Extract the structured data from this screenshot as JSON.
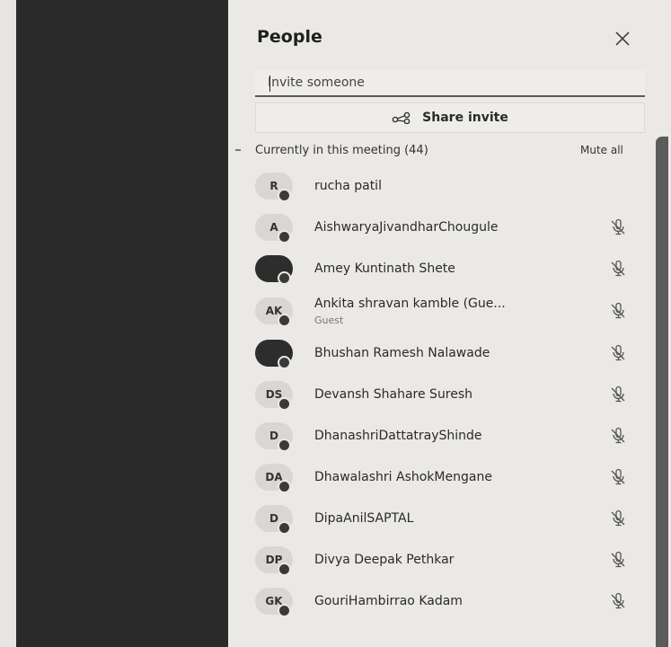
{
  "panel": {
    "title": "People",
    "invite_placeholder": "Invite someone",
    "share_label": "Share invite",
    "section_title": "Currently in this meeting (44)",
    "mute_all_label": "Mute all"
  },
  "participants": [
    {
      "initials": "R",
      "name": "rucha patil",
      "sub": "",
      "muted": false,
      "dark": false
    },
    {
      "initials": "A",
      "name": "AishwaryaJivandharChougule",
      "sub": "",
      "muted": true,
      "dark": false
    },
    {
      "initials": "",
      "name": "Amey Kuntinath Shete",
      "sub": "",
      "muted": true,
      "dark": true
    },
    {
      "initials": "AK",
      "name": "Ankita shravan kamble (Gue...",
      "sub": "Guest",
      "muted": true,
      "dark": false
    },
    {
      "initials": "",
      "name": "Bhushan Ramesh Nalawade",
      "sub": "",
      "muted": true,
      "dark": true
    },
    {
      "initials": "DS",
      "name": "Devansh Shahare Suresh",
      "sub": "",
      "muted": true,
      "dark": false
    },
    {
      "initials": "D",
      "name": "DhanashriDattatrayShinde",
      "sub": "",
      "muted": true,
      "dark": false
    },
    {
      "initials": "DA",
      "name": "Dhawalashri AshokMengane",
      "sub": "",
      "muted": true,
      "dark": false
    },
    {
      "initials": "D",
      "name": "DipaAnilSAPTAL",
      "sub": "",
      "muted": true,
      "dark": false
    },
    {
      "initials": "DP",
      "name": "Divya Deepak Pethkar",
      "sub": "",
      "muted": true,
      "dark": false
    },
    {
      "initials": "GK",
      "name": "GouriHambirrao Kadam",
      "sub": "",
      "muted": true,
      "dark": false
    }
  ]
}
